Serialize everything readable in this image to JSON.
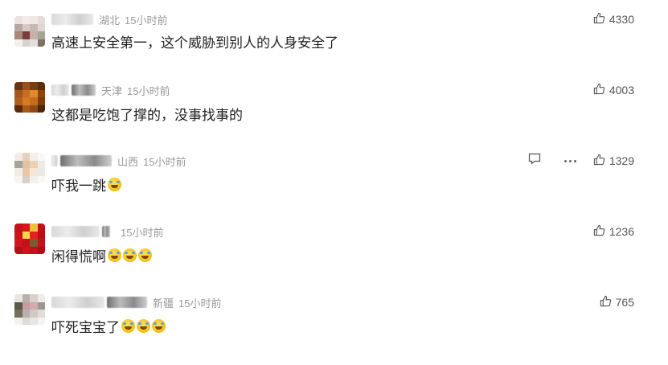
{
  "comments": [
    {
      "location": "湖北",
      "time": "15小时前",
      "text": "高速上安全第一，这个威胁到别人的人身安全了",
      "emojis": 0,
      "likes": "4330"
    },
    {
      "location": "天津",
      "time": "15小时前",
      "text": "这都是吃饱了撑的，没事找事的",
      "emojis": 0,
      "likes": "4003"
    },
    {
      "location": "山西",
      "time": "15小时前",
      "text": "吓我一跳",
      "emojis": 1,
      "likes": "1329"
    },
    {
      "location": "",
      "time": "15小时前",
      "text": "闲得慌啊",
      "emojis": 3,
      "likes": "1236"
    },
    {
      "location": "新疆",
      "time": "15小时前",
      "text": "吓死宝宝了",
      "emojis": 3,
      "likes": "765"
    }
  ],
  "icons": {
    "like": "thumbs-up-icon",
    "reply": "comment-icon",
    "more": "more-icon",
    "emoji": "crying-laughing-emoji"
  },
  "colors": {
    "meta": "#9a9a9a",
    "text": "#222222"
  }
}
